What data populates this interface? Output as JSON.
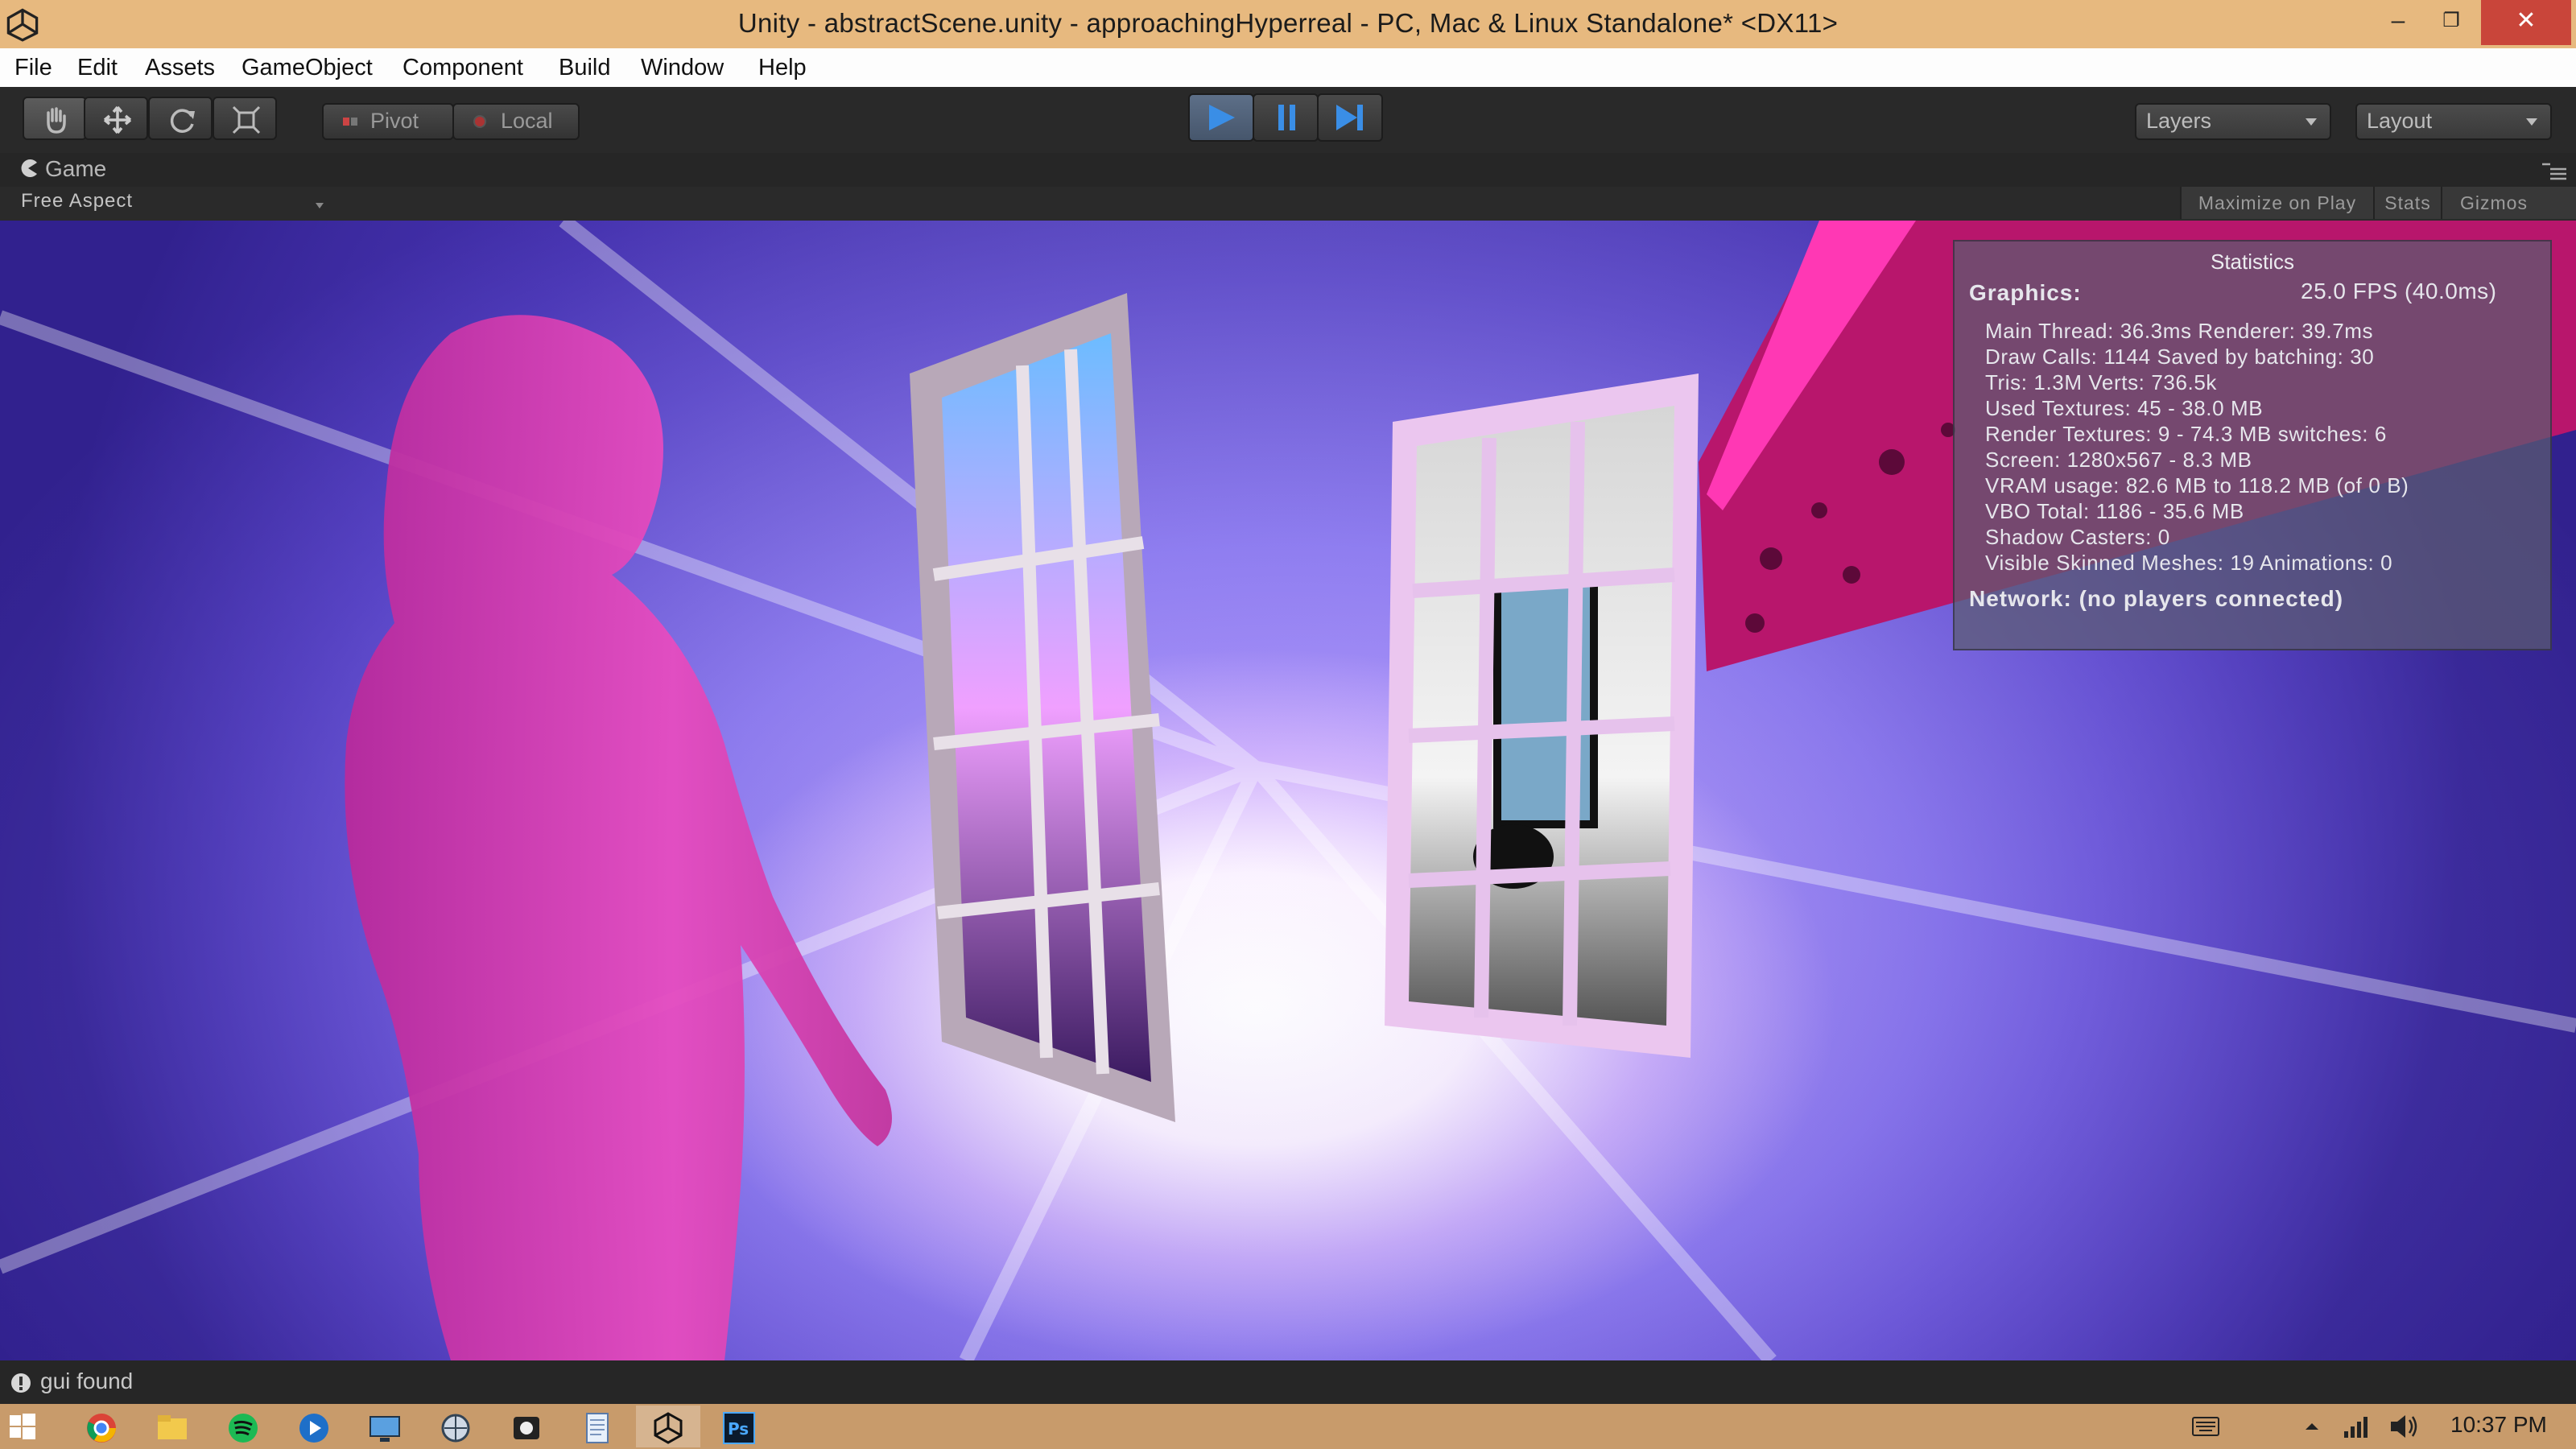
{
  "window": {
    "title": "Unity - abstractScene.unity - approachingHyperreal - PC, Mac & Linux Standalone* <DX11>",
    "minimize_glyph": "–",
    "maximize_glyph": "❐",
    "close_glyph": "✕"
  },
  "menubar": {
    "items": [
      "File",
      "Edit",
      "Assets",
      "GameObject",
      "Component",
      "Build",
      "Window",
      "Help"
    ]
  },
  "toolbar": {
    "tools": [
      "hand-icon",
      "move-icon",
      "rotate-icon",
      "scale-icon"
    ],
    "pivot_label": "Pivot",
    "local_label": "Local",
    "playback": [
      "play-icon",
      "pause-icon",
      "step-icon"
    ],
    "play_active": true,
    "layers_label": "Layers",
    "layout_label": "Layout",
    "accent_color": "#3a8ee6"
  },
  "game_panel": {
    "tab_label": "Game",
    "aspect_label": "Free Aspect",
    "maximize_label": "Maximize on Play",
    "stats_label": "Stats",
    "gizmos_label": "Gizmos"
  },
  "statistics": {
    "title": "Statistics",
    "graphics_label": "Graphics:",
    "fps": "25.0 FPS (40.0ms)",
    "lines": [
      "Main Thread: 36.3ms  Renderer: 39.7ms",
      "Draw Calls: 1144  Saved by batching: 30",
      "Tris: 1.3M    Verts: 736.5k",
      "Used Textures: 45 - 38.0 MB",
      "Render Textures: 9 - 74.3 MB    switches: 6",
      "Screen: 1280x567 - 8.3 MB",
      "VRAM usage: 82.6 MB to 118.2 MB (of 0 B)",
      "VBO Total: 1186 - 35.6 MB",
      "Shadow Casters: 0",
      "Visible Skinned Meshes: 19     Animations: 0"
    ],
    "network": "Network: (no players connected)"
  },
  "statusbar": {
    "message": "gui found",
    "icon": "info-icon"
  },
  "taskbar": {
    "apps": [
      "windows-start-icon",
      "chrome-icon",
      "file-explorer-icon",
      "spotify-icon",
      "media-player-icon",
      "remote-desktop-icon",
      "network-icon",
      "camera-icon",
      "notepad-icon",
      "unity-icon",
      "photoshop-icon"
    ],
    "photoshop_label": "Ps",
    "clock": "10:37 PM"
  },
  "colors": {
    "titlebar": "#e7b97f",
    "viewport_magenta": "#e040b0",
    "viewport_violet": "#6a5ae0"
  }
}
